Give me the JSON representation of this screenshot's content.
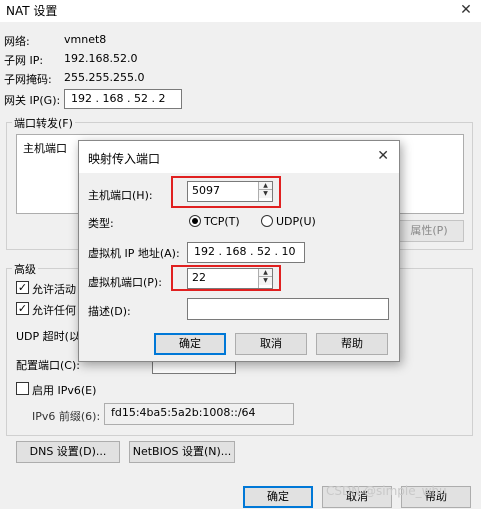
{
  "window": {
    "title": "NAT 设置",
    "close": "✕"
  },
  "info": {
    "network_label": "网络:",
    "network_value": "vmnet8",
    "subnet_ip_label": "子网 IP:",
    "subnet_ip_value": "192.168.52.0",
    "subnet_mask_label": "子网掩码:",
    "subnet_mask_value": "255.255.255.0",
    "gateway_label": "网关 IP(G):",
    "gateway_value": "192 . 168 . 52 . 2"
  },
  "port_forward": {
    "group_label": "端口转发(F)",
    "column_host_port": "主机端口",
    "properties_button": "属性(P)"
  },
  "advanced": {
    "group_label": "高级",
    "allow_active_ftp": "允许活动",
    "allow_any_oui": "允许任何",
    "udp_timeout": "UDP 超时(以",
    "config_port": "配置端口(C):",
    "enable_ipv6": "启用 IPv6(E)",
    "ipv6_prefix_label": "IPv6 前缀(6):",
    "ipv6_prefix_value": "fd15:4ba5:5a2b:1008::/64",
    "dns_button": "DNS 设置(D)...",
    "netbios_button": "NetBIOS 设置(N)..."
  },
  "footer": {
    "ok": "确定",
    "cancel": "取消",
    "help": "帮助",
    "watermark": "CSDN @simple_whu"
  },
  "dialog": {
    "title": "映射传入端口",
    "close": "✕",
    "host_port_label": "主机端口(H):",
    "host_port_value": "5097",
    "type_label": "类型:",
    "tcp_label": "TCP(T)",
    "udp_label": "UDP(U)",
    "selected_type": "TCP",
    "vm_ip_label": "虚拟机 IP 地址(A):",
    "vm_ip_value": "192 . 168 . 52 . 10",
    "vm_port_label": "虚拟机端口(P):",
    "vm_port_value": "22",
    "desc_label": "描述(D):",
    "desc_value": "",
    "ok": "确定",
    "cancel": "取消",
    "help": "帮助"
  },
  "icons": {
    "spin_up": "▲",
    "spin_down": "▼",
    "check": "✓"
  },
  "colors": {
    "highlight": "#e02020",
    "default_button_border": "#0078d7"
  }
}
